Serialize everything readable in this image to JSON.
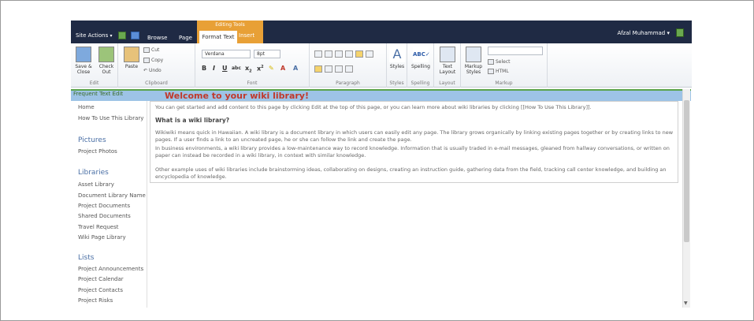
{
  "topbar": {
    "site_actions": "Site Actions",
    "tabs": {
      "browse": "Browse",
      "page": "Page"
    },
    "editing_tools": "Editing Tools",
    "format_text": "Format Text",
    "insert": "Insert",
    "user": "Afzal Muhammad"
  },
  "ribbon": {
    "edit": {
      "save_close": "Save & Close",
      "check_out": "Check Out",
      "label": "Edit"
    },
    "clipboard": {
      "paste": "Paste",
      "cut": "Cut",
      "copy": "Copy",
      "undo": "Undo",
      "label": "Clipboard"
    },
    "font": {
      "family": "Verdana",
      "size": "8pt",
      "label": "Font"
    },
    "paragraph": {
      "label": "Paragraph"
    },
    "styles": {
      "button": "Styles",
      "label": "Styles"
    },
    "spelling": {
      "button": "Spelling",
      "label": "Spelling"
    },
    "layout": {
      "button": "Text Layout",
      "label": "Layout"
    },
    "markup": {
      "button": "Markup Styles",
      "select": "Select",
      "html": "HTML",
      "label": "Markup"
    }
  },
  "title_bar": {
    "breadcrumb": "Frequent Text Edit",
    "title": "Welcome to your wiki library!"
  },
  "leftnav": {
    "items_top": [
      "Home",
      "How To Use This Library"
    ],
    "pictures_heading": "Pictures",
    "pictures_items": [
      "Project Photos"
    ],
    "libraries_heading": "Libraries",
    "libraries_items": [
      "Asset Library",
      "Document Library Name",
      "Project Documents",
      "Shared Documents",
      "Travel Request",
      "Wiki Page Library"
    ],
    "lists_heading": "Lists",
    "lists_items": [
      "Project Announcements",
      "Project Calendar",
      "Project Contacts",
      "Project Risks"
    ]
  },
  "content": {
    "intro": "You can get started and add content to this page by clicking Edit at the top of this page, or you can learn more about wiki libraries by clicking [[How To Use This Library]].",
    "heading": "What is a wiki library?",
    "p1": "Wikiwiki means quick in Hawaiian. A wiki library is a document library in which users can easily edit any page. The library grows organically by linking existing pages together or by creating links to new pages. If a user finds a link to an uncreated page, he or she can follow the link and create the page.",
    "p2": "In business environments, a wiki library provides a low-maintenance way to record knowledge. Information that is usually traded in e-mail messages, gleaned from hallway conversations, or written on paper can instead be recorded in a wiki library, in context with similar knowledge.",
    "p3": "Other example uses of wiki libraries include brainstorming ideas, collaborating on designs, creating an instruction guide, gathering data from the field, tracking call center knowledge, and building an encyclopedia of knowledge."
  }
}
